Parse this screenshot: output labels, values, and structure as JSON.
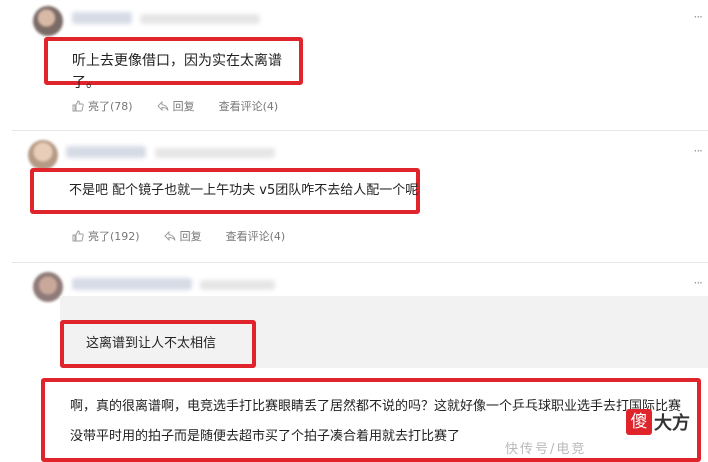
{
  "comments": [
    {
      "text": "听上去更像借口，因为实在太离谱了。",
      "like_label": "亮了(78)",
      "reply_label": "回复",
      "view_label": "查看评论(4)"
    },
    {
      "text": "不是吧 配个镜子也就一上午功夫 v5团队咋不去给人配一个呢",
      "like_label": "亮了(192)",
      "reply_label": "回复",
      "view_label": "查看评论(4)"
    },
    {
      "quote": "这离谱到让人不太相信",
      "text": "啊，真的很离谱啊，电竞选手打比赛眼睛丢了居然都不说的吗？这就好像一个乒乓球职业选手去打国际比赛没带平时用的拍子而是随便去超市买了个拍子凑合着用就去打比赛了"
    }
  ],
  "more_label": "···",
  "watermark": {
    "partial_text": "快传号/电竞",
    "logo_char": "傻",
    "logo_text": "大方"
  }
}
